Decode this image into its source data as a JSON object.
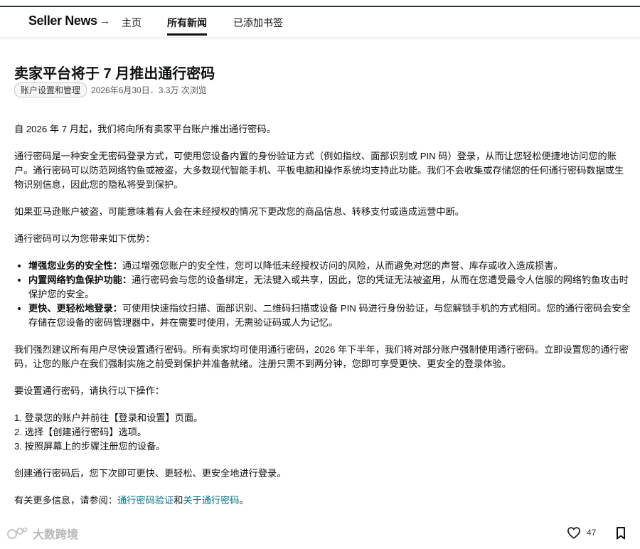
{
  "nav": {
    "brand": "Seller News",
    "arrow": "→",
    "links": [
      "主页",
      "所有新闻",
      "已添加书签"
    ]
  },
  "article": {
    "title": "卖家平台将于 7 月推出通行密码",
    "tag": "账户设置和管理",
    "meta": "2026年6月30日．3.3万 次浏览",
    "p1": "自 2026 年 7 月起，我们将向所有卖家平台账户推出通行密码。",
    "p2": "通行密码是一种安全无密码登录方式，可使用您设备内置的身份验证方式（例如指纹、面部识别或 PIN 码）登录，从而让您轻松便捷地访问您的账户。通行密码可以防范网络钓鱼或被盗，大多数现代智能手机、平板电脑和操作系统均支持此功能。我们不会收集或存储您的任何通行密码数据或生物识别信息，因此您的隐私将受到保护。",
    "p3": "如果亚马逊账户被盗，可能意味着有人会在未经授权的情况下更改您的商品信息、转移支付或造成运营中断。",
    "p4": "通行密码可以为您带来如下优势：",
    "benefits": [
      {
        "title": "增强您业务的安全性：",
        "text": "通过增强您账户的安全性，您可以降低未经授权访问的风险，从而避免对您的声誉、库存或收入造成损害。"
      },
      {
        "title": "内置网络钓鱼保护功能：",
        "text": "通行密码会与您的设备绑定，无法键入或共享，因此，您的凭证无法被盗用，从而在您遭受最令人信服的网络钓鱼攻击时保护您的安全。"
      },
      {
        "title": "更快、更轻松地登录：",
        "text": "可使用快速指纹扫描、面部识别、二维码扫描或设备 PIN 码进行身份验证，与您解锁手机的方式相同。您的通行密码会安全存储在您设备的密码管理器中，并在需要时使用，无需验证码或人为记忆。"
      }
    ],
    "p5": "我们强烈建议所有用户尽快设置通行密码。所有卖家均可使用通行密码，2026 年下半年，我们将对部分账户强制使用通行密码。立即设置您的通行密码，让您的账户在我们强制实施之前受到保护并准备就绪。注册只需不到两分钟，您即可享受更快、更安全的登录体验。",
    "p6": "要设置通行密码，请执行以下操作：",
    "steps": [
      "1. 登录您的账户并前往【登录和设置】页面。",
      "2. 选择【创建通行密码】选项。",
      "3. 按照屏幕上的步骤注册您的设备。"
    ],
    "p7": "创建通行密码后，您下次即可更快、更轻松、更安全地进行登录。",
    "more_prefix": "有关更多信息，请参阅：",
    "link1": "通行密码验证",
    "link_joiner": "和",
    "link2": "关于通行密码",
    "more_suffix": "。"
  },
  "footer": {
    "watermark": "大数跨境",
    "likes": "47",
    "icons": [
      "heart-icon",
      "bookmark-icon",
      "watermark-logo-icon"
    ]
  },
  "colors": {
    "link": "#007185",
    "text": "#0f1111",
    "topline": "#2f3a40"
  }
}
